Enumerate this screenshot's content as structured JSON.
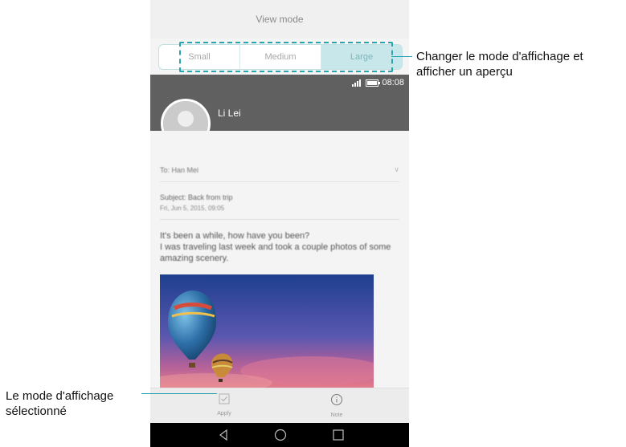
{
  "header": {
    "title": "View mode"
  },
  "view_mode": {
    "options": [
      {
        "label": "Small",
        "active": false
      },
      {
        "label": "Medium",
        "active": false
      },
      {
        "label": "Large",
        "active": true
      }
    ]
  },
  "status_bar": {
    "time": "08:08"
  },
  "email": {
    "sender": "Li Lei",
    "to": "To: Han Mei",
    "subject": "Subject: Back from trip",
    "date": "Fri, Jun 5, 2015, 09:05",
    "body_line1": "It's been a while, how have you been?",
    "body_line2": "I was traveling last week and took a couple photos of some amazing scenery."
  },
  "bottom_bar": {
    "apply_label": "Apply",
    "note_label": "Note"
  },
  "annotations": {
    "top": "Changer le mode d'affichage et afficher un aperçu",
    "bottom": "Le mode d'affichage sélectionné"
  },
  "colors": {
    "accent": "#2aa3b1",
    "active_segment": "#c7e7ea",
    "header_bg": "#606060"
  }
}
